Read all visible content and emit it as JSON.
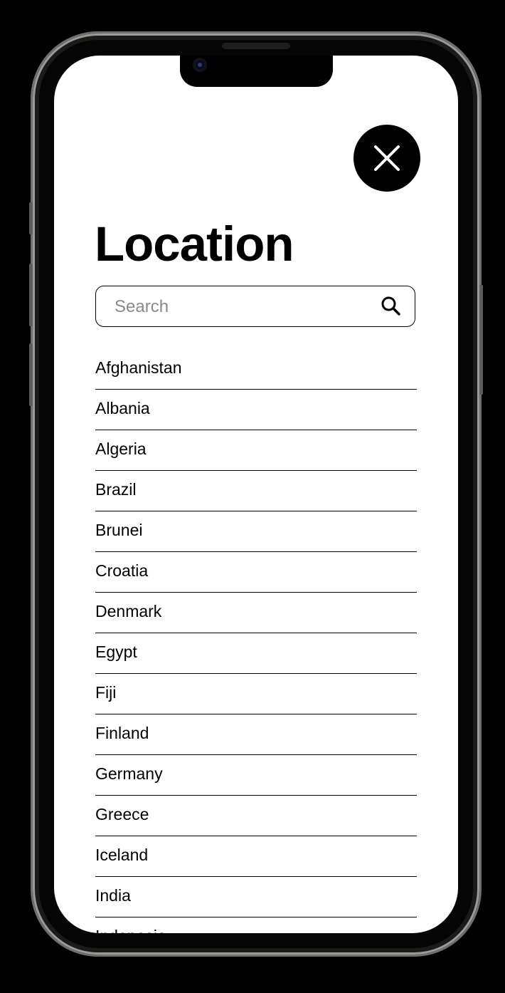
{
  "header": {
    "title": "Location",
    "close_icon": "close-icon"
  },
  "search": {
    "placeholder": "Search",
    "value": "",
    "icon": "search-icon"
  },
  "countries": [
    "Afghanistan",
    "Albania",
    "Algeria",
    "Brazil",
    "Brunei",
    "Croatia",
    "Denmark",
    "Egypt",
    "Fiji",
    "Finland",
    "Germany",
    "Greece",
    "Iceland",
    "India",
    "Indonesia"
  ],
  "colors": {
    "background": "#ffffff",
    "text": "#000000",
    "accent": "#000000",
    "placeholder": "#8a8a8a"
  }
}
